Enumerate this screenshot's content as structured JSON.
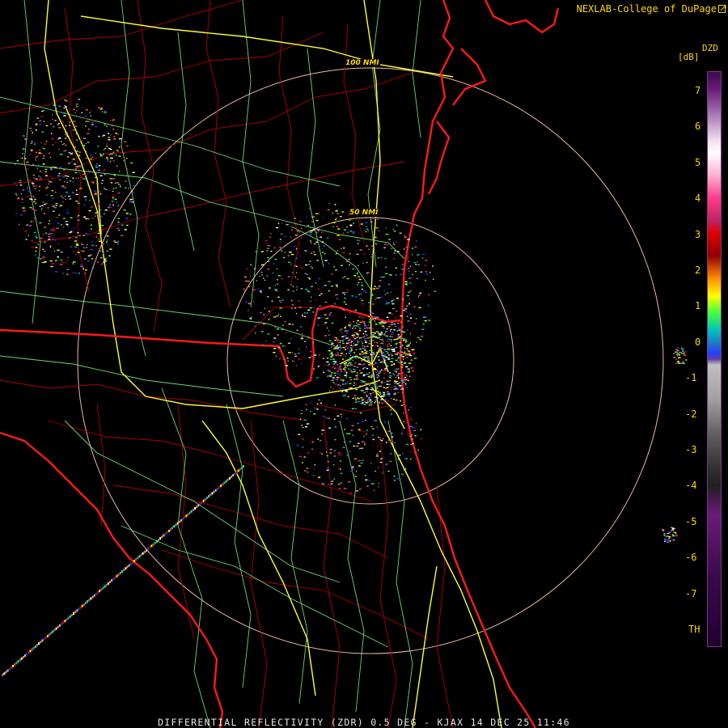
{
  "credit": "NEXLAB-College of DuPage",
  "credit_icon": "external-link-icon",
  "footer": "DIFFERENTIAL REFLECTIVITY (ZDR) 0.5 DEG - KJAX 14 DEC 25 11:46",
  "rings": [
    {
      "label": "100 NMI"
    },
    {
      "label": "50 NMI"
    }
  ],
  "legend": {
    "units": "[dB]",
    "product": "DZD",
    "ticks": [
      "7",
      "6",
      "5",
      "4",
      "3",
      "2",
      "1",
      "0",
      "-1",
      "-2",
      "-3",
      "-4",
      "-5",
      "-6",
      "-7",
      "TH"
    ],
    "colors": {
      "top": "#f0e0f0",
      "pink": "#ff3a8c",
      "red": "#e00000",
      "orange": "#ff9000",
      "yellow": "#ffff00",
      "green": "#40ff40",
      "cyan": "#00c0c0",
      "blue": "#2040ff",
      "gray": "#c0c0c0",
      "purple": "#6a1a7a"
    }
  },
  "map_colors": {
    "state_border": "#ff1a1a",
    "county_border": "#b00000",
    "highway": "#ffff33",
    "road": "#7fff7f",
    "range_ring": "#f0b8a0"
  }
}
